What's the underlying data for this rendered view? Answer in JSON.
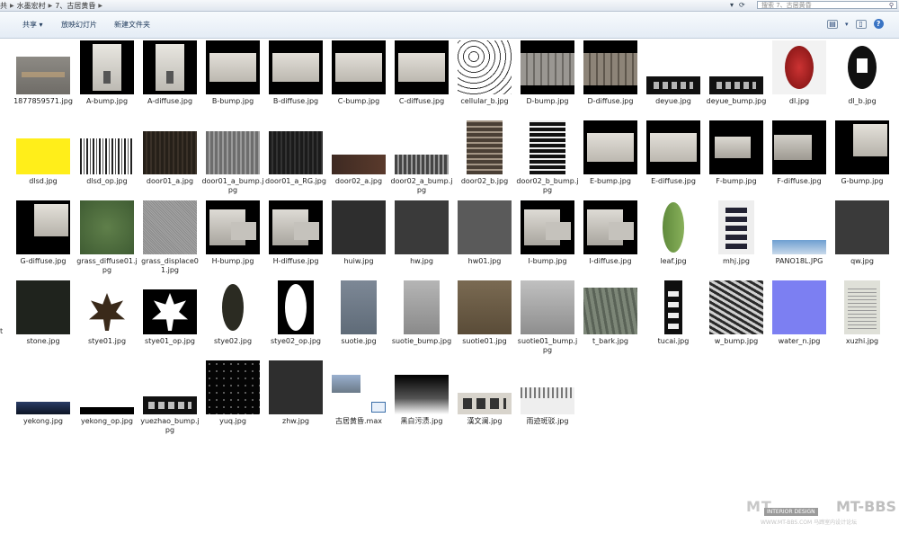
{
  "breadcrumb": {
    "prefix": "共",
    "items": [
      "水墨宏村",
      "7、古居黄昏"
    ]
  },
  "search": {
    "placeholder": "搜索 7、古居黄昏"
  },
  "toolbar": {
    "share": "共享",
    "slideshow": "放映幻灯片",
    "new_folder": "新建文件夹"
  },
  "edge_char": "t",
  "watermark": {
    "logo": "MT",
    "badge": "INTERIOR DESIGN",
    "bbs": "MT-BBS",
    "sub": "WWW.MT-BBS.COM 马蹄室内设计论坛"
  },
  "files": [
    {
      "name": "1877859571.jpg",
      "thumb": "sign"
    },
    {
      "name": "A-bump.jpg",
      "thumb": "facade"
    },
    {
      "name": "A-diffuse.jpg",
      "thumb": "facade"
    },
    {
      "name": "B-bump.jpg",
      "thumb": "wall"
    },
    {
      "name": "B-diffuse.jpg",
      "thumb": "wall"
    },
    {
      "name": "C-bump.jpg",
      "thumb": "wall"
    },
    {
      "name": "C-diffuse.jpg",
      "thumb": "wall"
    },
    {
      "name": "cellular_b.jpg",
      "thumb": "cells"
    },
    {
      "name": "D-bump.jpg",
      "thumb": "stonewall"
    },
    {
      "name": "D-diffuse.jpg",
      "thumb": "stonewall2"
    },
    {
      "name": "deyue.jpg",
      "thumb": "blackplaque"
    },
    {
      "name": "deyue_bump.jpg",
      "thumb": "blackplaque"
    },
    {
      "name": "dl.jpg",
      "thumb": "lantern"
    },
    {
      "name": "dl_b.jpg",
      "thumb": "lanternbw"
    },
    {
      "name": "dlsd.jpg",
      "thumb": "yellow"
    },
    {
      "name": "dlsd_op.jpg",
      "thumb": "stripes"
    },
    {
      "name": "door01_a.jpg",
      "thumb": "darkwood"
    },
    {
      "name": "door01_a_bump.jpg",
      "thumb": "greywood"
    },
    {
      "name": "door01_a_RG.jpg",
      "thumb": "darkwood2"
    },
    {
      "name": "door02_a.jpg",
      "thumb": "brownstrip"
    },
    {
      "name": "door02_a_bump.jpg",
      "thumb": "greystrip"
    },
    {
      "name": "door02_b.jpg",
      "thumb": "lattice"
    },
    {
      "name": "door02_b_bump.jpg",
      "thumb": "latticebw"
    },
    {
      "name": "E-bump.jpg",
      "thumb": "wall"
    },
    {
      "name": "E-diffuse.jpg",
      "thumb": "wall"
    },
    {
      "name": "F-bump.jpg",
      "thumb": "wallsmall"
    },
    {
      "name": "F-diffuse.jpg",
      "thumb": "wallsmall2"
    },
    {
      "name": "G-bump.jpg",
      "thumb": "cornerwall"
    },
    {
      "name": "G-diffuse.jpg",
      "thumb": "cornerwall"
    },
    {
      "name": "grass_diffuse01.jpg",
      "thumb": "grass"
    },
    {
      "name": "grass_displace01.jpg",
      "thumb": "noise"
    },
    {
      "name": "H-bump.jpg",
      "thumb": "facade2"
    },
    {
      "name": "H-diffuse.jpg",
      "thumb": "facade2"
    },
    {
      "name": "huiw.jpg",
      "thumb": "darkgrey"
    },
    {
      "name": "hw.jpg",
      "thumb": "darkgrey2"
    },
    {
      "name": "hw01.jpg",
      "thumb": "midgrey"
    },
    {
      "name": "I-bump.jpg",
      "thumb": "facade2"
    },
    {
      "name": "I-diffuse.jpg",
      "thumb": "facade2"
    },
    {
      "name": "leaf.jpg",
      "thumb": "leaf"
    },
    {
      "name": "mhj.jpg",
      "thumb": "calligraphy"
    },
    {
      "name": "PANO18L.JPG",
      "thumb": "pano"
    },
    {
      "name": "qw.jpg",
      "thumb": "darkgrey2"
    },
    {
      "name": "stone.jpg",
      "thumb": "stone"
    },
    {
      "name": "stye01.jpg",
      "thumb": "mapleleaf"
    },
    {
      "name": "stye01_op.jpg",
      "thumb": "mapleleafop"
    },
    {
      "name": "stye02.jpg",
      "thumb": "leaf2"
    },
    {
      "name": "stye02_op.jpg",
      "thumb": "leaf2op"
    },
    {
      "name": "suotie.jpg",
      "thumb": "rust"
    },
    {
      "name": "suotie_bump.jpg",
      "thumb": "rustbw"
    },
    {
      "name": "suotie01.jpg",
      "thumb": "rust2"
    },
    {
      "name": "suotie01_bump.jpg",
      "thumb": "rust2bw"
    },
    {
      "name": "t_bark.jpg",
      "thumb": "bark"
    },
    {
      "name": "tucai.jpg",
      "thumb": "tucai"
    },
    {
      "name": "w_bump.jpg",
      "thumb": "wbump"
    },
    {
      "name": "water_n.jpg",
      "thumb": "waternormal"
    },
    {
      "name": "xuzhi.jpg",
      "thumb": "paper"
    },
    {
      "name": "yekong.jpg",
      "thumb": "nightsky"
    },
    {
      "name": "yekong_op.jpg",
      "thumb": "nightskyop"
    },
    {
      "name": "yuezhao_bump.jpg",
      "thumb": "yuezhao"
    },
    {
      "name": "yuq.jpg",
      "thumb": "stars"
    },
    {
      "name": "zhw.jpg",
      "thumb": "darkgrey"
    },
    {
      "name": "古居黄昏.max",
      "thumb": "maxfile"
    },
    {
      "name": "黑白污渍.jpg",
      "thumb": "stains"
    },
    {
      "name": "漢文澜.jpg",
      "thumb": "hanwenlan"
    },
    {
      "name": "雨迹斑驳.jpg",
      "thumb": "rainstain"
    }
  ]
}
